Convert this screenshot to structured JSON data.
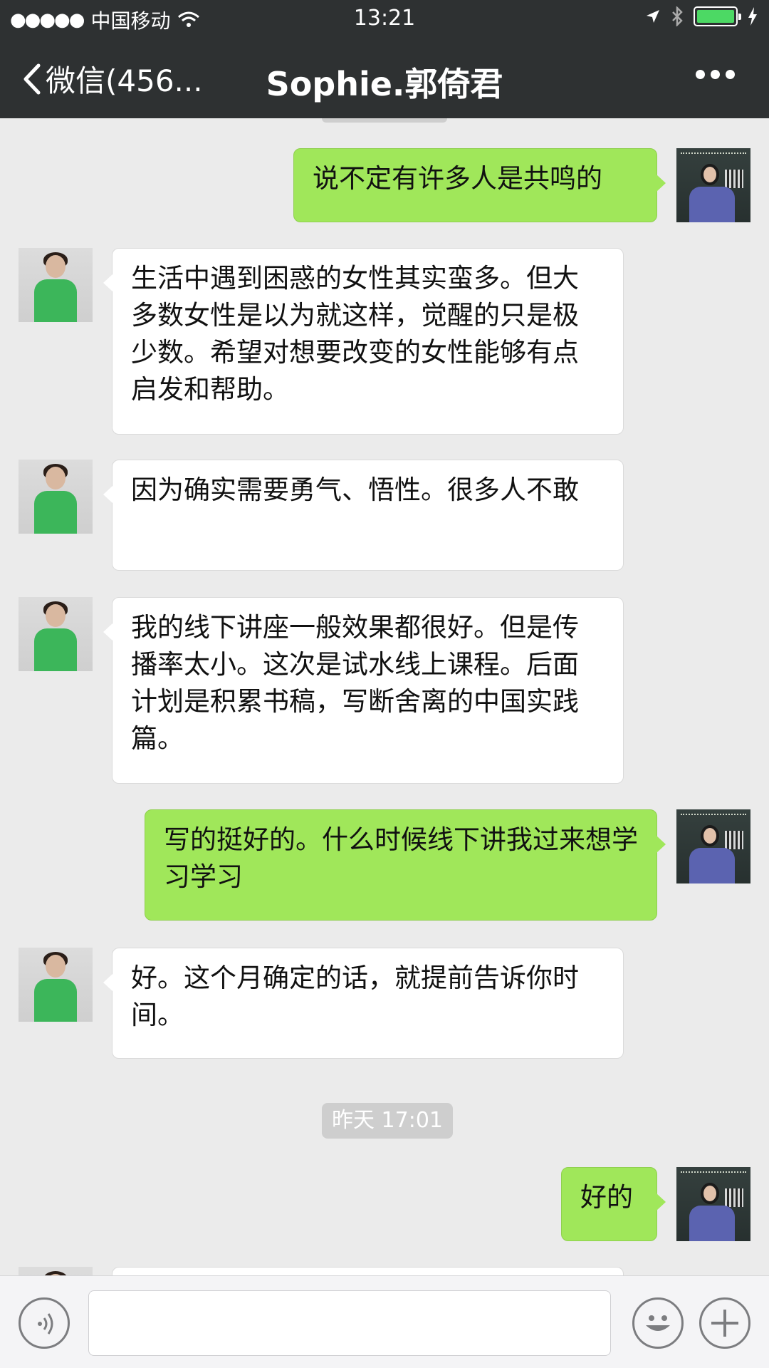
{
  "status_bar": {
    "signal_dots": "●●●●●",
    "carrier": "中国移动",
    "time": "13:21",
    "battery_color": "#4cd964"
  },
  "nav": {
    "back_label": "微信(456...",
    "title": "Sophie.郭倚君",
    "more_icon": "ellipsis-icon"
  },
  "messages": [
    {
      "side": "out",
      "text": "说不定有许多人是共鸣的"
    },
    {
      "side": "in",
      "text": "生活中遇到困惑的女性其实蛮多。但大多数女性是以为就这样，觉醒的只是极少数。希望对想要改变的女性能够有点启发和帮助。"
    },
    {
      "side": "in",
      "text": "因为确实需要勇气、悟性。很多人不敢"
    },
    {
      "side": "in",
      "text": "我的线下讲座一般效果都很好。但是传播率太小。这次是试水线上课程。后面计划是积累书稿，写断舍离的中国实践篇。"
    },
    {
      "side": "out",
      "text": "写的挺好的。什么时候线下讲我过来想学习学习"
    },
    {
      "side": "in",
      "text": "好。这个月确定的话，就提前告诉你时间。"
    },
    {
      "side": "out",
      "text": "好的"
    }
  ],
  "timestamp": "昨天 17:01",
  "input_bar": {
    "voice_icon": "voice-icon",
    "emoji_icon": "emoji-icon",
    "plus_icon": "plus-icon",
    "text_value": ""
  },
  "colors": {
    "outgoing_bubble": "#a0e75a",
    "incoming_bubble": "#ffffff",
    "header_bg": "#2e3132",
    "chat_bg": "#ebebeb"
  }
}
